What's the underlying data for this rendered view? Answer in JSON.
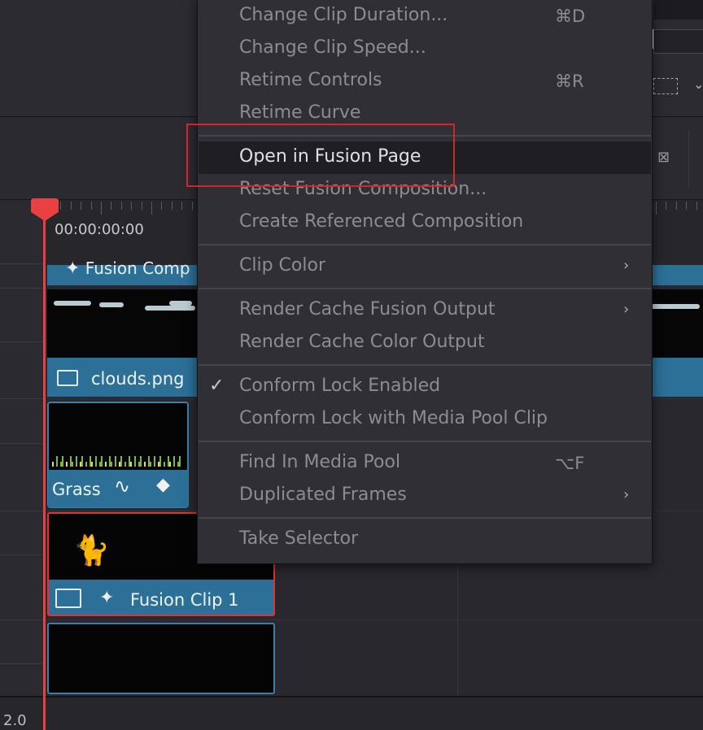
{
  "timeline": {
    "timecode": "00:00:00:00",
    "bottom_label": "2.0",
    "clips": {
      "fusion_comp_label": "Fusion Comp",
      "clouds_label": "clouds.png",
      "grass_label": "Grass",
      "fusion_clip_label": "Fusion Clip 1"
    }
  },
  "context_menu": {
    "items": [
      {
        "label": "Change Clip Duration...",
        "shortcut": "⌘D"
      },
      {
        "label": "Change Clip Speed..."
      },
      {
        "label": "Retime Controls",
        "shortcut": "⌘R"
      },
      {
        "label": "Retime Curve"
      },
      {
        "label": "Open in Fusion Page"
      },
      {
        "label": "Reset Fusion Composition..."
      },
      {
        "label": "Create Referenced Composition"
      },
      {
        "label": "Clip Color",
        "has_submenu": true
      },
      {
        "label": "Render Cache Fusion Output",
        "has_submenu": true
      },
      {
        "label": "Render Cache Color Output"
      },
      {
        "label": "Conform Lock Enabled",
        "checked": true
      },
      {
        "label": "Conform Lock with Media Pool Clip"
      },
      {
        "label": "Find In Media Pool",
        "shortcut": "⌥F"
      },
      {
        "label": "Duplicated Frames",
        "has_submenu": true
      },
      {
        "label": "Take Selector"
      }
    ]
  },
  "icons": {
    "submenu_arrow": "chevron-right-icon",
    "check": "checkmark-icon",
    "clip_image": "image-icon",
    "fusion": "sparkle-icon",
    "curve": "curve-icon",
    "keyframe": "keyframe-icon"
  },
  "colors": {
    "clip_blue": "#2c6f97",
    "playhead_red": "#e84141",
    "annotation_red": "#d0282a",
    "menu_bg": "#2f2f35"
  }
}
